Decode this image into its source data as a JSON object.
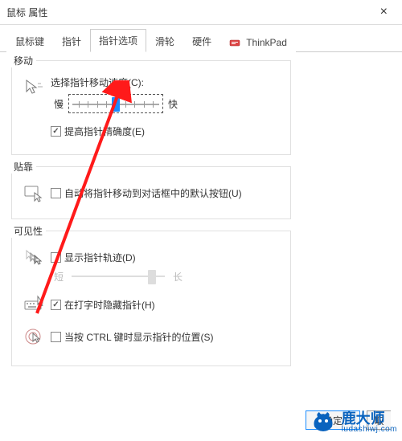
{
  "window": {
    "title": "鼠标 属性",
    "close": "×"
  },
  "tabs": [
    {
      "label": "鼠标键",
      "active": false
    },
    {
      "label": "指针",
      "active": false
    },
    {
      "label": "指针选项",
      "active": true
    },
    {
      "label": "滑轮",
      "active": false
    },
    {
      "label": "硬件",
      "active": false
    },
    {
      "label": "ThinkPad",
      "active": false,
      "icon": true
    }
  ],
  "groups": {
    "motion": {
      "title": "移动",
      "speed_label": "选择指针移动速度(C):",
      "slow": "慢",
      "fast": "快",
      "precision_label": "提高指针精确度(E)",
      "precision_checked": true,
      "slider_position": 0.5
    },
    "snap": {
      "title": "贴靠",
      "label": "自动将指针移动到对话框中的默认按钮(U)",
      "checked": false
    },
    "visibility": {
      "title": "可见性",
      "trails_label": "显示指针轨迹(D)",
      "trails_checked": false,
      "trails_short": "短",
      "trails_long": "长",
      "trails_position": 0.85,
      "hide_typing_label": "在打字时隐藏指针(H)",
      "hide_typing_checked": true,
      "ctrl_label": "当按 CTRL 键时显示指针的位置(S)",
      "ctrl_checked": false
    }
  },
  "buttons": {
    "ok": "确定",
    "cancel": "取"
  },
  "watermark": {
    "text": "鹿大师",
    "sub": "ludashiwj.com"
  }
}
